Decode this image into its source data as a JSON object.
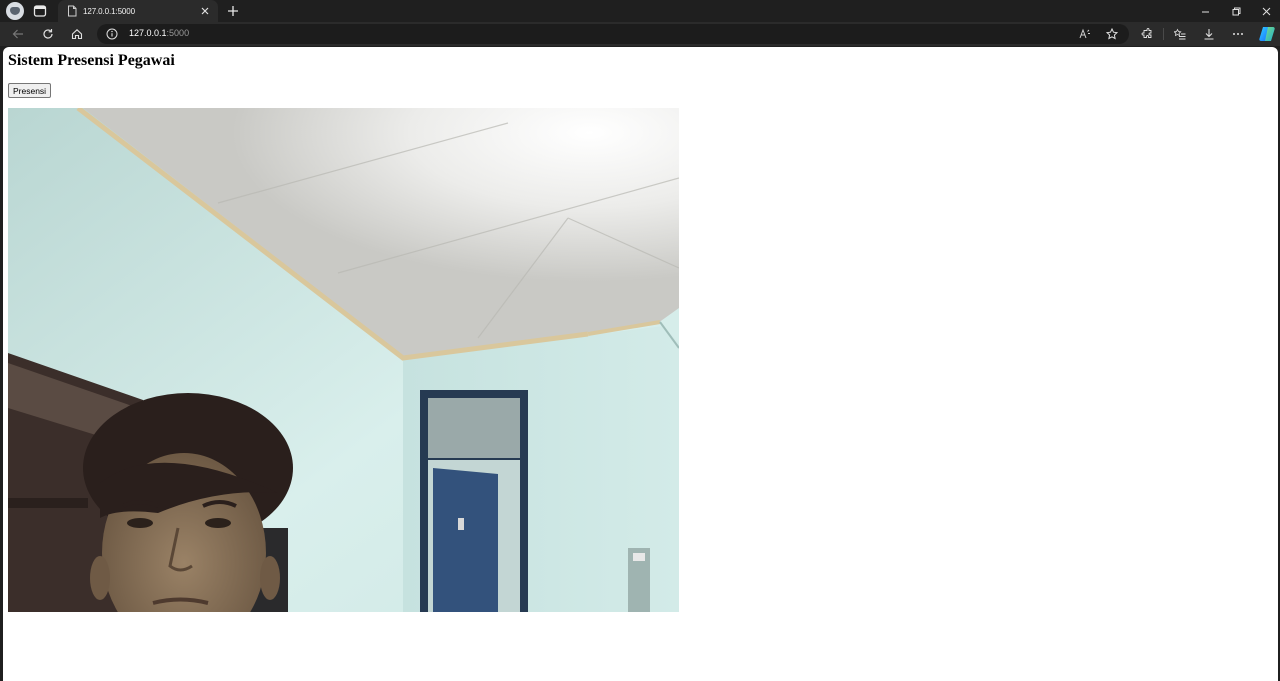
{
  "browser": {
    "tab": {
      "title": "127.0.0.1:5000"
    },
    "address": {
      "host": "127.0.0.1",
      "port": ":5000"
    }
  },
  "page": {
    "heading": "Sistem Presensi Pegawai",
    "button_label": "Presensi",
    "video": {
      "description_icon": "camera-feed"
    }
  },
  "colors": {
    "chrome_dark": "#1f1f1f",
    "toolbar": "#2b2b2b",
    "page_bg": "#ffffff",
    "wall": "#cfe6e3",
    "ceiling": "#dcdcd8",
    "door": "#2f4a6b"
  }
}
